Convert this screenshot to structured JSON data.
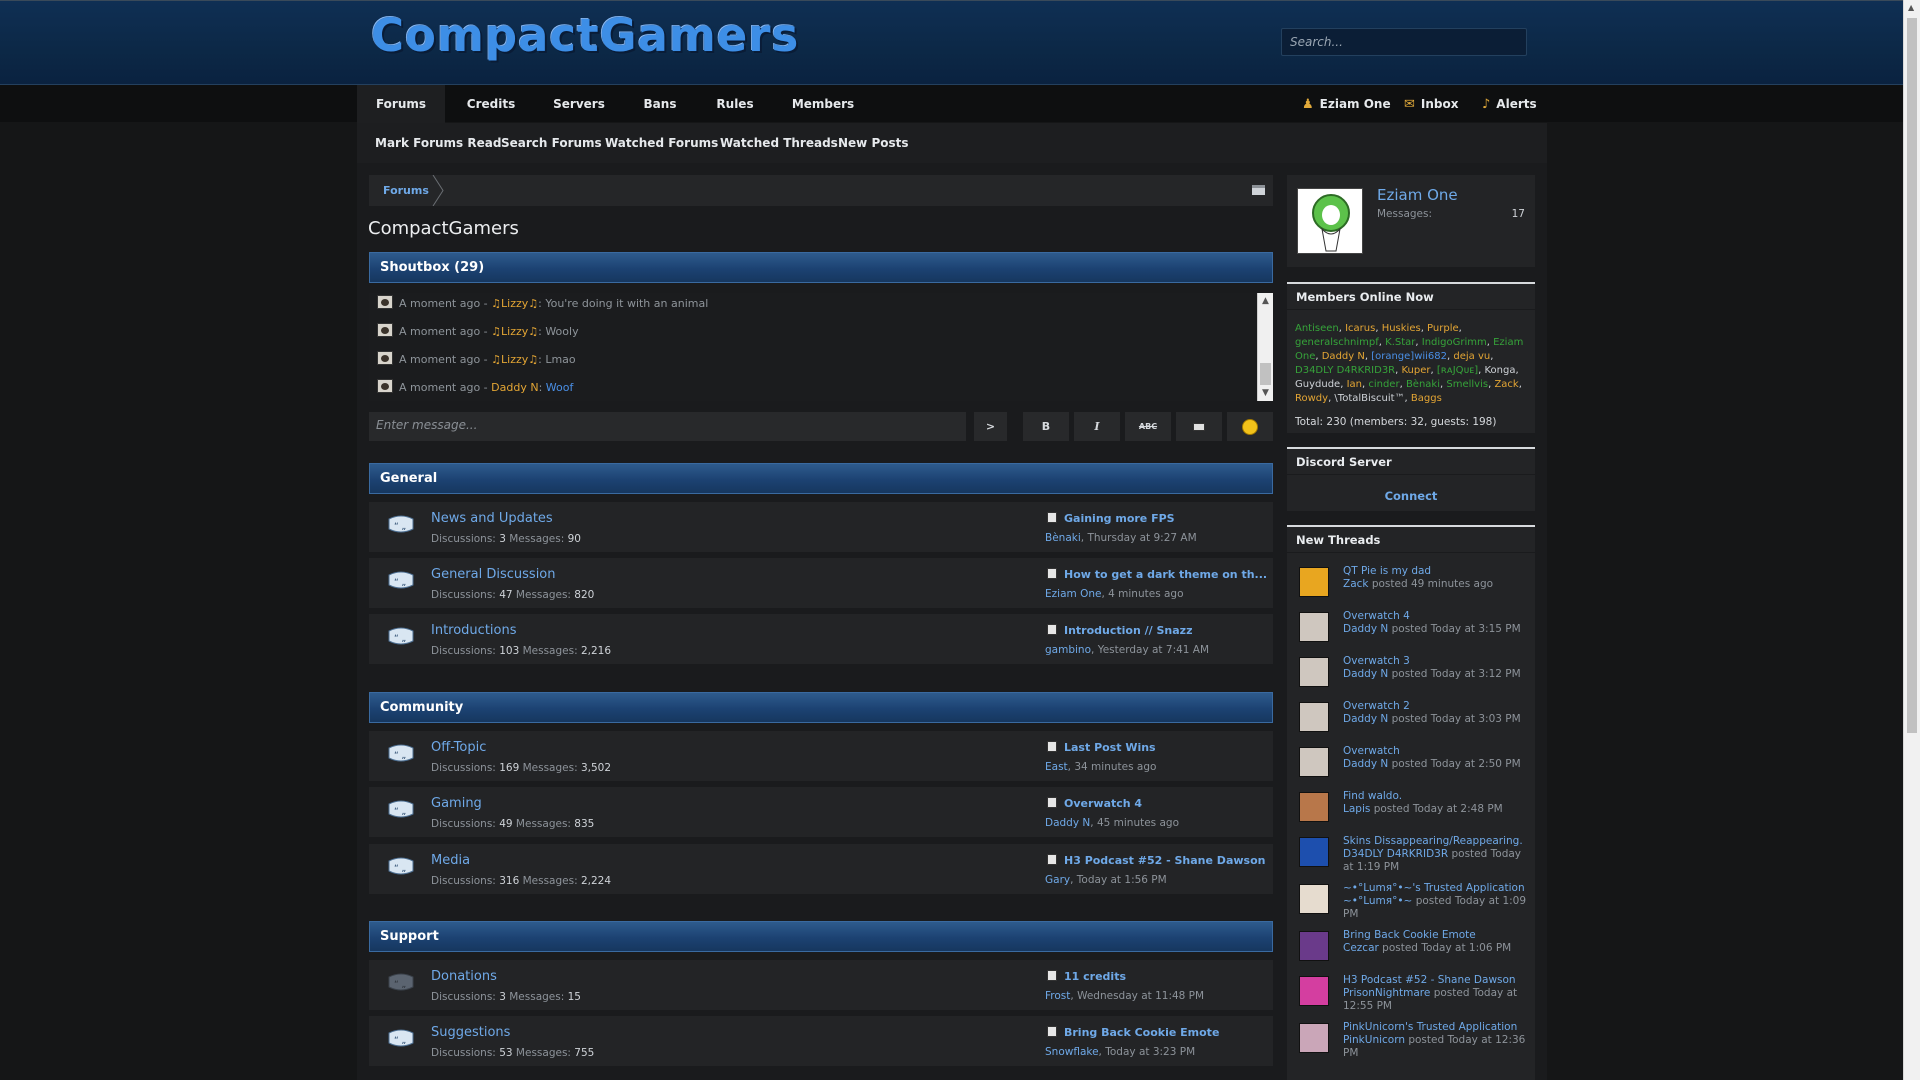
{
  "header": {
    "logo": "CompactGamers",
    "search_placeholder": "Search..."
  },
  "nav": {
    "tabs": [
      "Forums",
      "Credits",
      "Servers",
      "Bans",
      "Rules",
      "Members"
    ],
    "user": "Eziam One",
    "inbox": "Inbox",
    "alerts": "Alerts"
  },
  "subnav": [
    "Mark Forums Read",
    "Search Forums",
    "Watched Forums",
    "Watched Threads",
    "New Posts"
  ],
  "breadcrumb": "Forums",
  "page_title": "CompactGamers",
  "shoutbox": {
    "title": "Shoutbox (29)",
    "lines": [
      {
        "time": "A moment ago",
        "user": "♫Lizzy♫",
        "msg": "You're doing it with an animal"
      },
      {
        "time": "A moment ago",
        "user": "♫Lizzy♫",
        "msg": "Wooly"
      },
      {
        "time": "A moment ago",
        "user": "♫Lizzy♫",
        "msg": "Lmao"
      },
      {
        "time": "A moment ago",
        "user": "Daddy N",
        "msg": "Woof"
      }
    ],
    "input_placeholder": "Enter message...",
    "send": ">",
    "bold": "B",
    "italic": "I",
    "strike": "ABC"
  },
  "categories": [
    {
      "title": "General",
      "forums": [
        {
          "name": "News and Updates",
          "discussions": "3",
          "messages": "90",
          "lp_title": "Gaining more FPS",
          "lp_user": "Bènaki",
          "lp_time": "Thursday at 9:27 AM"
        },
        {
          "name": "General Discussion",
          "discussions": "47",
          "messages": "820",
          "lp_title": "How to get a dark theme on th...",
          "lp_user": "Eziam One",
          "lp_time": "4 minutes ago"
        },
        {
          "name": "Introductions",
          "discussions": "103",
          "messages": "2,216",
          "lp_title": "Introduction // Snazz",
          "lp_user": "gambino",
          "lp_time": "Yesterday at 7:41 AM"
        }
      ]
    },
    {
      "title": "Community",
      "forums": [
        {
          "name": "Off-Topic",
          "discussions": "169",
          "messages": "3,502",
          "lp_title": "Last Post Wins",
          "lp_user": "East",
          "lp_time": "34 minutes ago"
        },
        {
          "name": "Gaming",
          "discussions": "49",
          "messages": "835",
          "lp_title": "Overwatch 4",
          "lp_user": "Daddy N",
          "lp_time": "45 minutes ago"
        },
        {
          "name": "Media",
          "discussions": "316",
          "messages": "2,224",
          "lp_title": "H3 Podcast #52 - Shane Dawson",
          "lp_user": "Gary",
          "lp_time": "Today at 1:56 PM"
        }
      ]
    },
    {
      "title": "Support",
      "forums": [
        {
          "name": "Donations",
          "discussions": "3",
          "messages": "15",
          "lp_title": "11 credits",
          "lp_user": "Frost",
          "lp_time": "Wednesday at 11:48 PM"
        },
        {
          "name": "Suggestions",
          "discussions": "53",
          "messages": "755",
          "lp_title": "Bring Back Cookie Emote",
          "lp_user": "Snowflake",
          "lp_time": "Today at 3:23 PM"
        }
      ]
    }
  ],
  "labels": {
    "discussions": "Discussions:",
    "messages": "Messages:"
  },
  "sidebar": {
    "profile": {
      "name": "Eziam One",
      "messages_label": "Messages:",
      "messages": "17"
    },
    "online": {
      "title": "Members Online Now",
      "members": [
        {
          "n": "Antiseen",
          "c": "g"
        },
        {
          "n": "Icarus",
          "c": "o"
        },
        {
          "n": "Huskies",
          "c": "o"
        },
        {
          "n": "Purple",
          "c": "o"
        },
        {
          "n": "generalschnimpf",
          "c": "g"
        },
        {
          "n": "K.Star",
          "c": "g"
        },
        {
          "n": "IndigoGrimm",
          "c": "g"
        },
        {
          "n": "Eziam One",
          "c": "g"
        },
        {
          "n": "Daddy N",
          "c": "o"
        },
        {
          "n": "[orange]wii682",
          "c": "b"
        },
        {
          "n": "deja vu",
          "c": "o"
        },
        {
          "n": "D34DLY D4RKRID3R",
          "c": "g"
        },
        {
          "n": "Kuper",
          "c": "o"
        },
        {
          "n": "[ʀᴀJQᴜᴇ]",
          "c": "g"
        },
        {
          "n": "Konga",
          "c": "w"
        },
        {
          "n": "Guydude",
          "c": "w"
        },
        {
          "n": "Ian",
          "c": "o"
        },
        {
          "n": "cinder",
          "c": "g"
        },
        {
          "n": "Bènaki",
          "c": "g"
        },
        {
          "n": "Smellvis",
          "c": "g"
        },
        {
          "n": "Zack",
          "c": "o"
        },
        {
          "n": "Rowdy",
          "c": "o"
        },
        {
          "n": "\\TotalBiscuit™",
          "c": "w"
        },
        {
          "n": "Baggs",
          "c": "o"
        }
      ],
      "total": "Total: 230 (members: 32, guests: 198)"
    },
    "discord": {
      "title": "Discord Server",
      "connect": "Connect"
    },
    "new_threads": {
      "title": "New Threads",
      "posted": "posted",
      "items": [
        {
          "title": "QT Pie is my dad",
          "user": "Zack",
          "time": "49 minutes ago",
          "color": "#e8a620"
        },
        {
          "title": "Overwatch 4",
          "user": "Daddy N",
          "time": "Today at 3:15 PM",
          "color": "#cfc7bf"
        },
        {
          "title": "Overwatch 3",
          "user": "Daddy N",
          "time": "Today at 3:12 PM",
          "color": "#cfc7bf"
        },
        {
          "title": "Overwatch 2",
          "user": "Daddy N",
          "time": "Today at 3:03 PM",
          "color": "#cfc7bf"
        },
        {
          "title": "Overwatch",
          "user": "Daddy N",
          "time": "Today at 2:50 PM",
          "color": "#cfc7bf"
        },
        {
          "title": "Find waldo.",
          "user": "Lapis",
          "time": "Today at 2:48 PM",
          "color": "#b8774a"
        },
        {
          "title": "Skins Dissappearing/Reappearing.",
          "user": "D34DLY D4RKRID3R",
          "time": "Today at 1:19 PM",
          "color": "#1d4fae"
        },
        {
          "title": "~•°Lumя°•~'s Trusted Application",
          "user": "~•°Lumя°•~",
          "time": "Today at 1:09 PM",
          "color": "#e6dccf"
        },
        {
          "title": "Bring Back Cookie Emote",
          "user": "Cezcar",
          "time": "Today at 1:06 PM",
          "color": "#6a3a8a"
        },
        {
          "title": "H3 Podcast #52 - Shane Dawson",
          "user": "PrisonNightmare",
          "time": "Today at 12:55 PM",
          "color": "#d43ea0"
        },
        {
          "title": "PinkUnicorn's Trusted Application",
          "user": "PinkUnicorn",
          "time": "Today at 12:36 PM",
          "color": "#caa6b8"
        }
      ]
    }
  }
}
